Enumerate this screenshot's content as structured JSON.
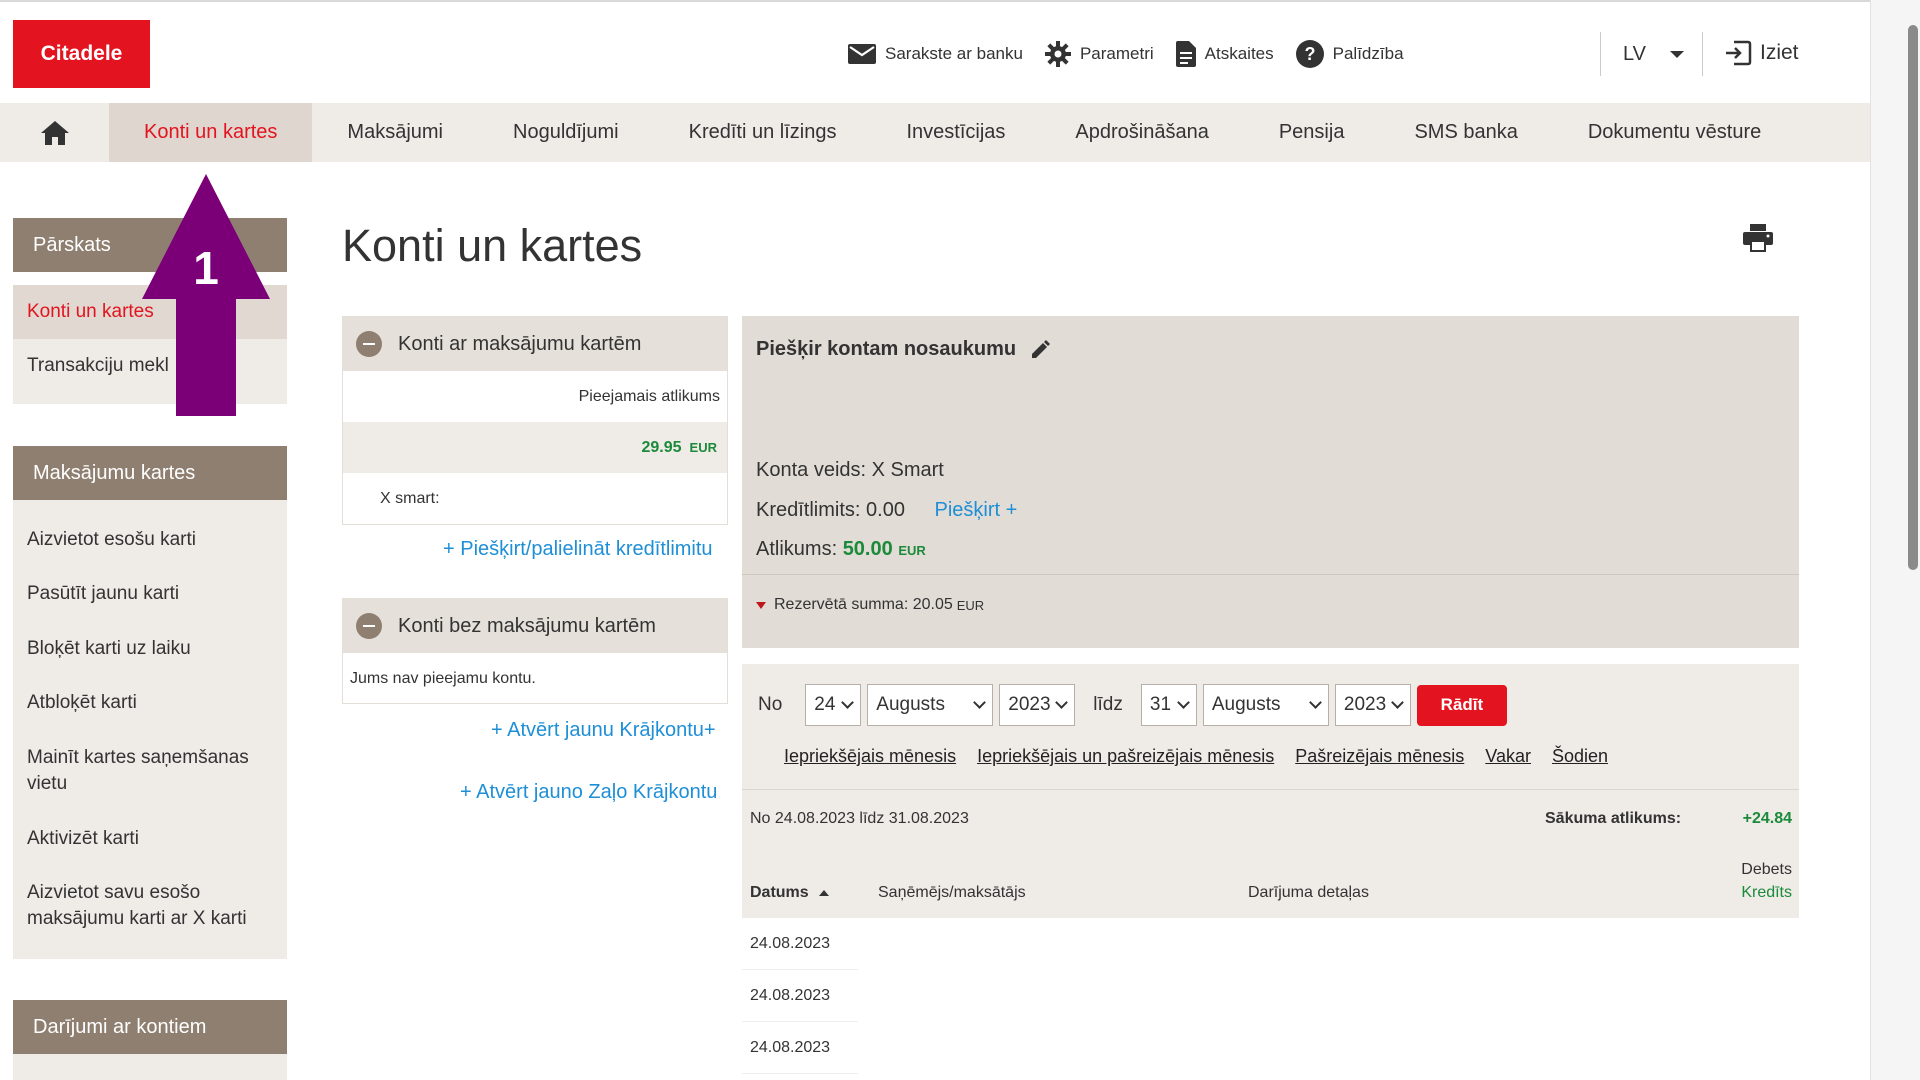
{
  "header": {
    "logo": "Citadele",
    "links": [
      {
        "label": "Sarakste ar banku",
        "icon": "envelope-icon"
      },
      {
        "label": "Parametri",
        "icon": "gear-icon"
      },
      {
        "label": "Atskaites",
        "icon": "document-icon"
      },
      {
        "label": "Palīdzība",
        "icon": "help-icon"
      }
    ],
    "language": "LV",
    "logout": "Iziet"
  },
  "nav": {
    "items": [
      "Konti un kartes",
      "Maksājumi",
      "Noguldījumi",
      "Kredīti un līzings",
      "Investīcijas",
      "Apdrošināšana",
      "Pensija",
      "SMS banka",
      "Dokumentu vēsture"
    ],
    "active": "Konti un kartes"
  },
  "sidebar": {
    "overview": {
      "title": "Pārskats",
      "items": [
        "Konti un kartes",
        "Transakciju mekl"
      ]
    },
    "cards": {
      "title": "Maksājumu kartes",
      "items": [
        "Aizvietot esošu karti",
        "Pasūtīt jaunu karti",
        "Bloķēt karti uz laiku",
        "Atbloķēt karti",
        "Mainīt kartes saņemšanas vietu",
        "Aktivizēt karti",
        "Aizvietot savu esošo maksājumu karti ar X karti"
      ]
    },
    "accounts": {
      "title": "Darījumi ar kontiem"
    }
  },
  "main": {
    "title": "Konti un kartes",
    "with_cards": {
      "title": "Konti ar maksājumu kartēm",
      "available_label": "Pieejamais atlikums",
      "balance": "29.95",
      "currency": "EUR",
      "account_name": "X smart:",
      "link": "+ Piešķirt/palielināt kredītlimitu"
    },
    "without_cards": {
      "title": "Konti bez maksājumu kartēm",
      "empty_text": "Jums nav pieejamu kontu.",
      "link_1": "+ Atvērt jaunu Krājkontu+",
      "link_2": "+ Atvērt jauno Zaļo Krājkontu"
    }
  },
  "detail": {
    "name_prompt": "Piešķir kontam nosaukumu",
    "account_type": "Konta veids: X Smart",
    "credit_limit": "Kredītlimits: 0.00",
    "assign_link": "Piešķirt +",
    "balance_label": "Atlikums:",
    "balance_value": "50.00",
    "currency": "EUR",
    "reserved": "Rezervētā summa: 20.05",
    "reserved_currency": "EUR"
  },
  "history": {
    "from_label": "No",
    "from_day": "24",
    "from_month": "Augusts",
    "from_year": "2023",
    "to_label": "līdz",
    "to_day": "31",
    "to_month": "Augusts",
    "to_year": "2023",
    "show_button": "Rādīt",
    "quick_links": [
      "Iepriekšējais mēnesis",
      "Iepriekšējais un pašreizējais mēnesis",
      "Pašreizējais mēnesis",
      "Vakar",
      "Šodien"
    ],
    "period": "No 24.08.2023 līdz 31.08.2023",
    "start_balance_label": "Sākuma atlikums:",
    "start_balance_value": "+24.84",
    "columns": {
      "date": "Datums",
      "party": "Saņēmējs/maksātājs",
      "details": "Darījuma detaļas",
      "debit": "Debets",
      "credit": "Kredīts"
    },
    "rows": [
      "24.08.2023",
      "24.08.2023",
      "24.08.2023"
    ]
  },
  "annotation": {
    "step_number": "1"
  },
  "colors": {
    "brand_red": "#e3141f",
    "sidebar_brown": "#8e7f70",
    "link_blue": "#1e8fd6",
    "positive_green": "#1b8a3a",
    "annotation_purple": "#7b0077"
  }
}
